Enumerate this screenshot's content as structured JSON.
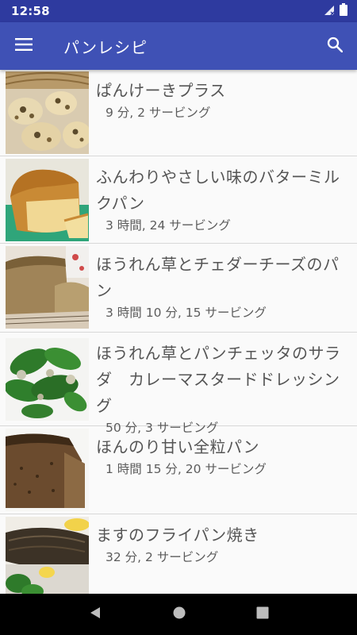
{
  "status": {
    "time": "12:58"
  },
  "app_bar": {
    "title": "パンレシピ",
    "menu_icon": "hamburger-menu-icon",
    "search_icon": "search-icon"
  },
  "recipes": [
    {
      "title": "ぱんけーきプラス",
      "meta": "9 分, 2 サービング",
      "image": "pancakes-photo"
    },
    {
      "title": "ふんわりやさしい味のバターミルクパン",
      "meta": "3 時間, 24 サービング",
      "image": "buttermilk-bread-photo"
    },
    {
      "title": "ほうれん草とチェダーチーズのパン",
      "meta": "3 時間 10 分, 15 サービング",
      "image": "spinach-cheddar-bread-photo"
    },
    {
      "title": "ほうれん草とパンチェッタのサラダ　カレーマスタードドレッシング",
      "meta": "50 分, 3 サービング",
      "image": "spinach-salad-photo"
    },
    {
      "title": "ほんのり甘い全粒パン",
      "meta": "1 時間 15 分, 20 サービング",
      "image": "whole-wheat-bread-photo"
    },
    {
      "title": "ますのフライパン焼き",
      "meta": "32 分, 2 サービング",
      "image": "pan-fried-trout-photo"
    }
  ],
  "colors": {
    "primary": "#3f51b5",
    "primary_dark": "#2e3a9f"
  }
}
